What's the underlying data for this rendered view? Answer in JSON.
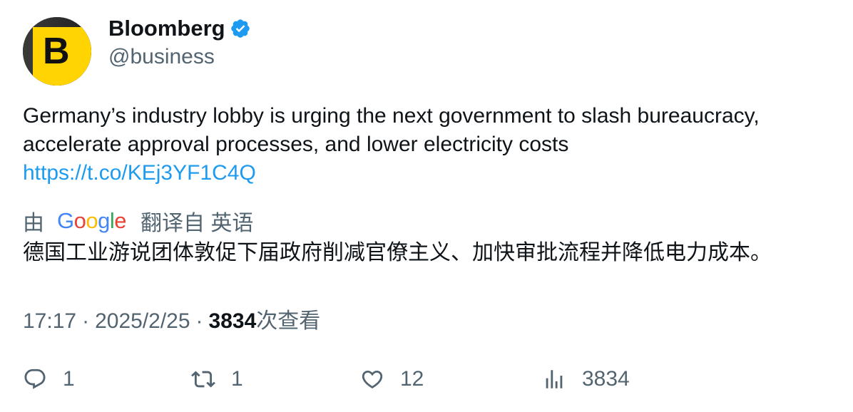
{
  "account": {
    "avatar_letter": "B",
    "display_name": "Bloomberg",
    "handle": "@business",
    "verified": true,
    "verified_color": "#1d9bf0"
  },
  "tweet": {
    "text_line1": "Germany’s industry lobby is urging the next government to slash bureaucracy,",
    "text_line2": "accelerate approval processes, and lower electricity costs",
    "link": "https://t.co/KEj3YF1C4Q"
  },
  "translation": {
    "by_label": "由",
    "provider_logo": {
      "g1": "G",
      "o1": "o",
      "o2": "o",
      "g2": "g",
      "l": "l",
      "e": "e"
    },
    "translate_label": "翻译自 英语",
    "translated_text": "德国工业游说团体敦促下届政府削减官僚主义、加快审批流程并降低电力成本。"
  },
  "meta": {
    "time": "17:17",
    "separator": "·",
    "date": "2025/2/25",
    "views_count": "3834",
    "views_label": "次查看"
  },
  "actions": {
    "reply_count": "1",
    "retweet_count": "1",
    "like_count": "12",
    "views_count": "3834"
  },
  "colors": {
    "link": "#1d9bf0",
    "secondary_text": "#536471",
    "primary_text": "#0f1419",
    "avatar_yellow": "#ffd400"
  }
}
